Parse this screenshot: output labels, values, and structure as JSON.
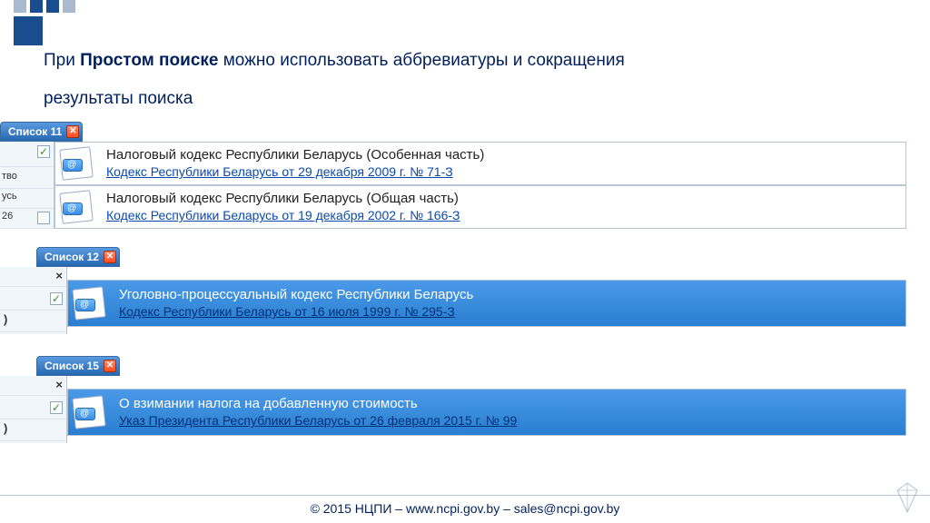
{
  "heading_pre": "При ",
  "heading_bold": "Простом поиске",
  "heading_post": " можно использовать аббревиатуры и сокращения",
  "subheading": "результаты поиска",
  "block1": {
    "tab": "Список 11",
    "frag_text1": "тво",
    "frag_text2": "усь",
    "frag_num": "26",
    "rows": [
      {
        "title": "Налоговый кодекс Республики Беларусь (Особенная часть)",
        "link": "Кодекс Республики Беларусь от 29 декабря 2009 г. № 71-З"
      },
      {
        "title": "Налоговый кодекс Республики Беларусь (Общая часть)",
        "link": "Кодекс Республики Беларусь от 19 декабря 2002 г. № 166-З"
      }
    ]
  },
  "block2": {
    "tab": "Список 12",
    "frag_text": ")",
    "row": {
      "title": "Уголовно-процессуальный кодекс Республики Беларусь",
      "link": "Кодекс Республики Беларусь от 16 июля 1999 г. № 295-З"
    }
  },
  "block3": {
    "tab": "Список 15",
    "frag_text": ")",
    "row": {
      "title": "О взимании налога на добавленную стоимость",
      "link": "Указ Президента Республики Беларусь от 26 февраля 2015 г. № 99"
    }
  },
  "footer": "© 2015 НЦПИ – www.ncpi.gov.by – sales@ncpi.gov.by",
  "close_glyph": "✕",
  "check_glyph": "✓"
}
